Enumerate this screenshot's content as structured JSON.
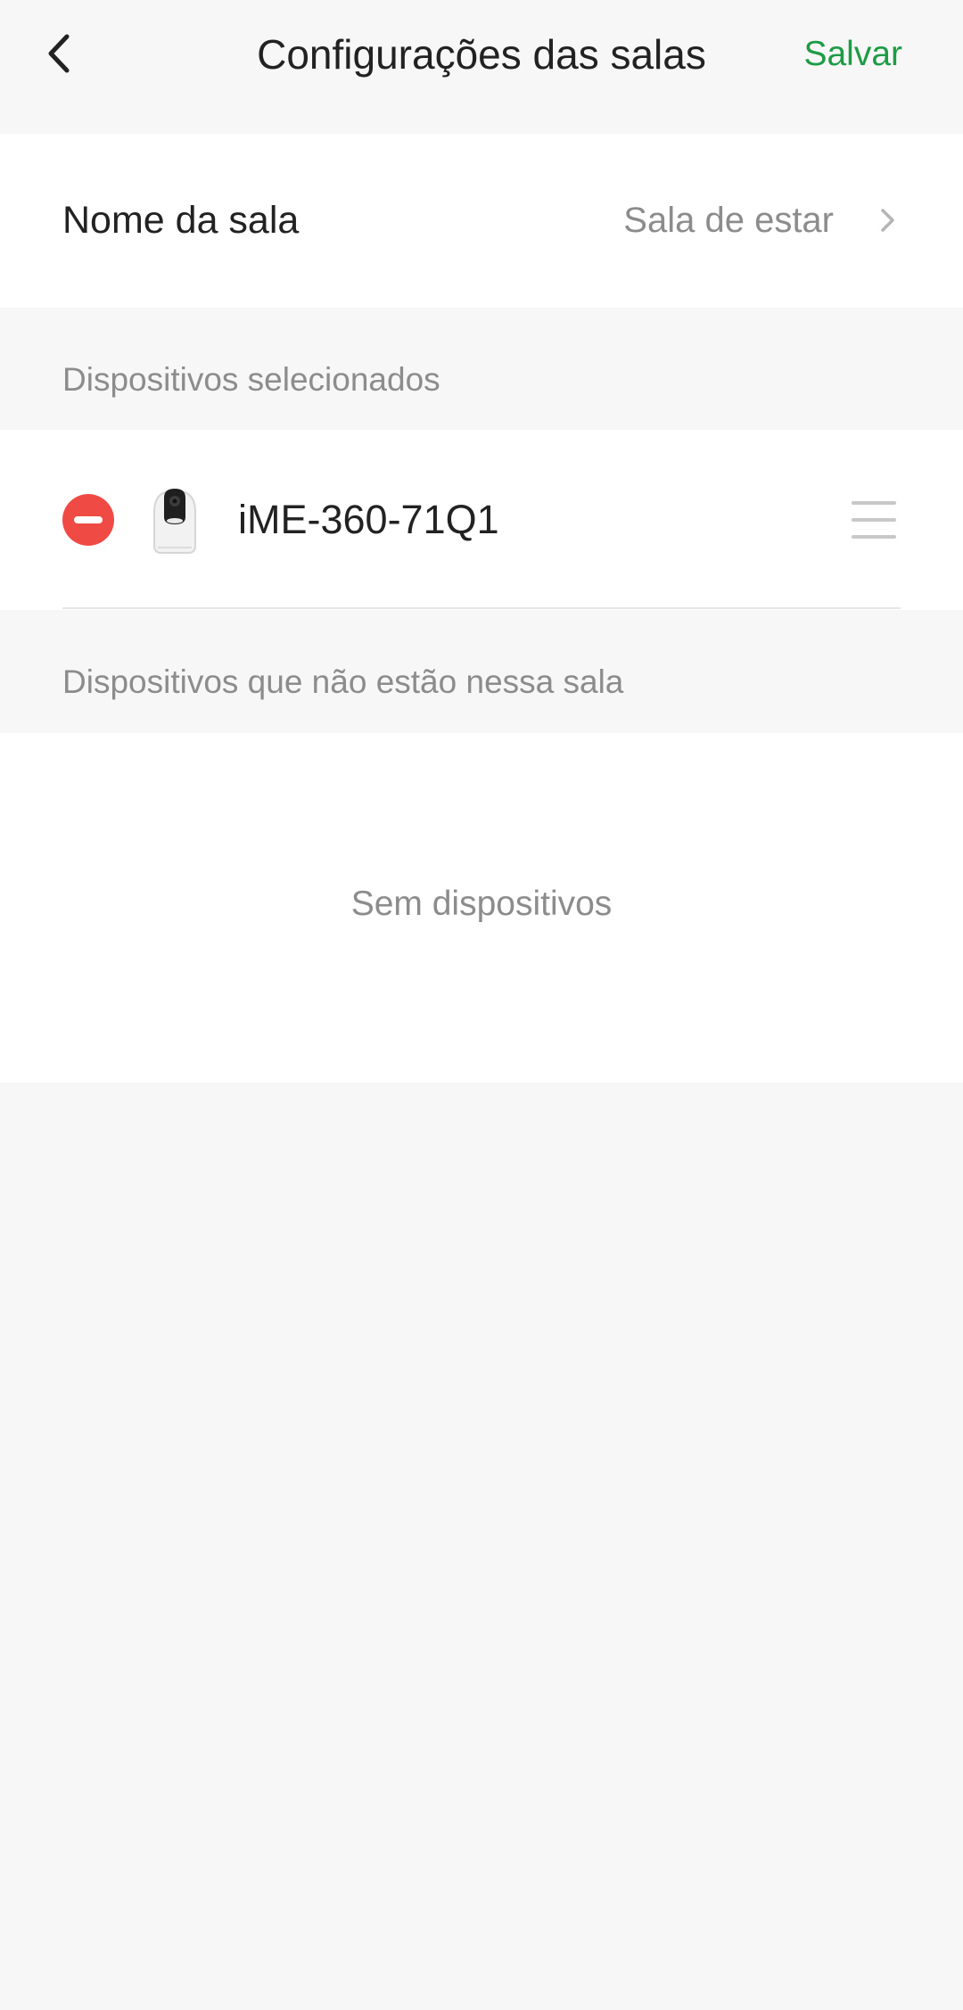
{
  "header": {
    "title": "Configurações das salas",
    "save_label": "Salvar",
    "accent_color": "#1e9c45"
  },
  "room_name": {
    "label": "Nome da sala",
    "value": "Sala de estar"
  },
  "selected_devices": {
    "section_title": "Dispositivos selecionados",
    "items": [
      {
        "name": "iME-360-71Q1",
        "icon": "camera-icon",
        "remove_color": "#f04a45"
      }
    ]
  },
  "other_devices": {
    "section_title": "Dispositivos que não estão nessa sala",
    "empty_text": "Sem dispositivos"
  }
}
